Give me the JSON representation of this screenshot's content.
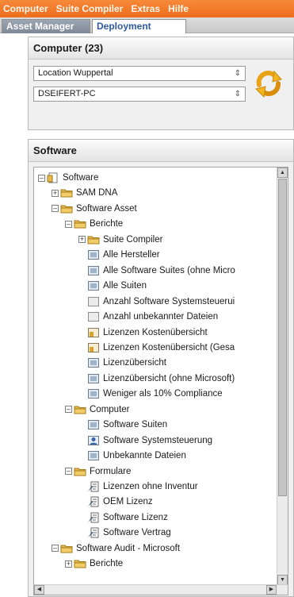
{
  "menu": [
    "Computer",
    "Suite Compiler",
    "Extras",
    "Hilfe"
  ],
  "tabs": [
    {
      "label": "Asset Manager",
      "active": false
    },
    {
      "label": "Deployment",
      "active": true
    }
  ],
  "computer_panel": {
    "title": "Computer (23)",
    "location_select": "Location Wuppertal",
    "computer_select": "DSEIFERT-PC",
    "refresh_icon": "refresh-arrows-icon"
  },
  "software_panel": {
    "title": "Software",
    "tree": [
      {
        "label": "Software",
        "icon": "root-icon",
        "toggle": "minus"
      },
      {
        "label": "SAM DNA",
        "icon": "folder-icon",
        "toggle": "plus"
      },
      {
        "label": "Software Asset",
        "icon": "folder-icon",
        "toggle": "minus"
      },
      {
        "label": "Berichte",
        "icon": "folder-icon",
        "toggle": "minus"
      },
      {
        "label": "Suite Compiler",
        "icon": "folder-icon",
        "toggle": "plus"
      },
      {
        "label": "Alle Hersteller",
        "icon": "report-icon"
      },
      {
        "label": "Alle Software Suites (ohne Micro",
        "icon": "report-icon"
      },
      {
        "label": "Alle Suiten",
        "icon": "report-icon"
      },
      {
        "label": "Anzahl Software Systemsteuerui",
        "icon": "blank-report-icon"
      },
      {
        "label": "Anzahl unbekannter Dateien",
        "icon": "blank-report-icon"
      },
      {
        "label": "Lizenzen Kostenübersicht",
        "icon": "cost-report-icon"
      },
      {
        "label": "Lizenzen Kostenübersicht (Gesa",
        "icon": "cost-report-icon"
      },
      {
        "label": "Lizenzübersicht",
        "icon": "report-icon"
      },
      {
        "label": "Lizenzübersicht (ohne Microsoft)",
        "icon": "report-icon"
      },
      {
        "label": "Weniger als 10% Compliance",
        "icon": "report-icon"
      },
      {
        "label": "Computer",
        "icon": "folder-icon",
        "toggle": "minus"
      },
      {
        "label": "Software Suiten",
        "icon": "report-icon"
      },
      {
        "label": "Software Systemsteuerung",
        "icon": "user-report-icon"
      },
      {
        "label": "Unbekannte Dateien",
        "icon": "report-icon"
      },
      {
        "label": "Formulare",
        "icon": "folder-icon",
        "toggle": "minus"
      },
      {
        "label": "Lizenzen ohne Inventur",
        "icon": "form-icon"
      },
      {
        "label": "OEM Lizenz",
        "icon": "form-icon"
      },
      {
        "label": "Software Lizenz",
        "icon": "form-icon"
      },
      {
        "label": "Software Vertrag",
        "icon": "form-icon"
      },
      {
        "label": "Software Audit - Microsoft",
        "icon": "folder-icon",
        "toggle": "minus"
      },
      {
        "label": "Berichte",
        "icon": "folder-icon",
        "toggle": "plus"
      }
    ]
  },
  "colors": {
    "menu_bar": "#ee6e1c",
    "active_tab_text": "#2f5aa0",
    "folder": "#e6b94a"
  }
}
